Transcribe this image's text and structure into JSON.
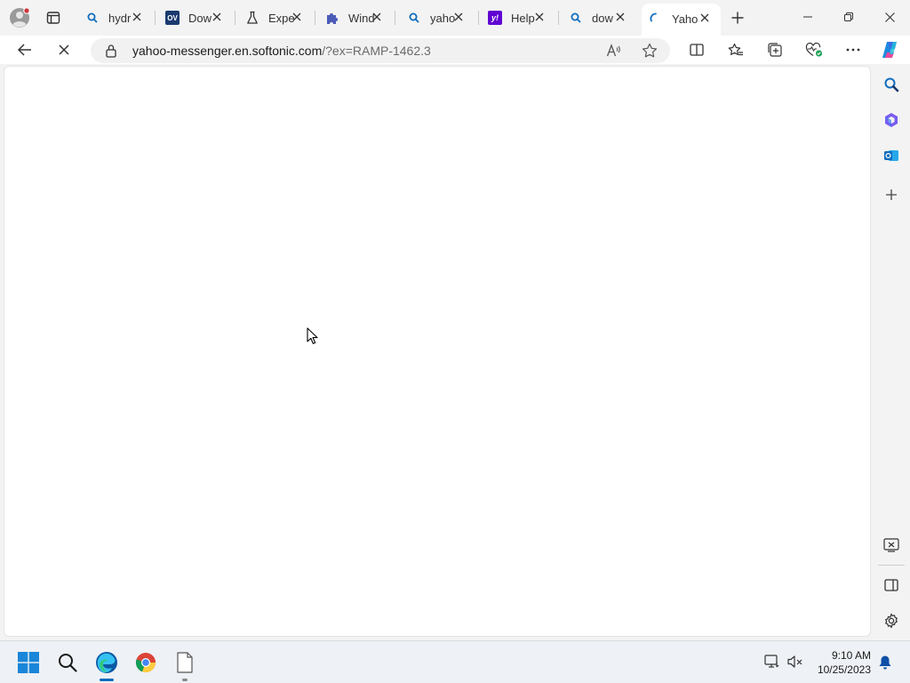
{
  "tabs": [
    {
      "title": "hydr",
      "favicon": "search-icon"
    },
    {
      "title": "Dow",
      "favicon": "ov-logo"
    },
    {
      "title": "Expe",
      "favicon": "flask-icon"
    },
    {
      "title": "Wind",
      "favicon": "puzzle-icon"
    },
    {
      "title": "yaho",
      "favicon": "search-icon"
    },
    {
      "title": "Help",
      "favicon": "yahoo-logo"
    },
    {
      "title": "dow",
      "favicon": "search-icon"
    },
    {
      "title": "Yaho",
      "favicon": "loading-spinner",
      "active": true
    }
  ],
  "ov_logo_text": "OV",
  "yahoo_logo_text": "y!",
  "address_bar": {
    "host": "yahoo-messenger.en.softonic.com",
    "path": "/?ex=RAMP-1462.3"
  },
  "taskbar": {
    "time": "9:10 AM",
    "date": "10/25/2023"
  },
  "colors": {
    "accent": "#0f6cbd",
    "yahoo_purple": "#6001d2",
    "ov_blue": "#1a3a6e",
    "notification_red": "#d13438"
  }
}
